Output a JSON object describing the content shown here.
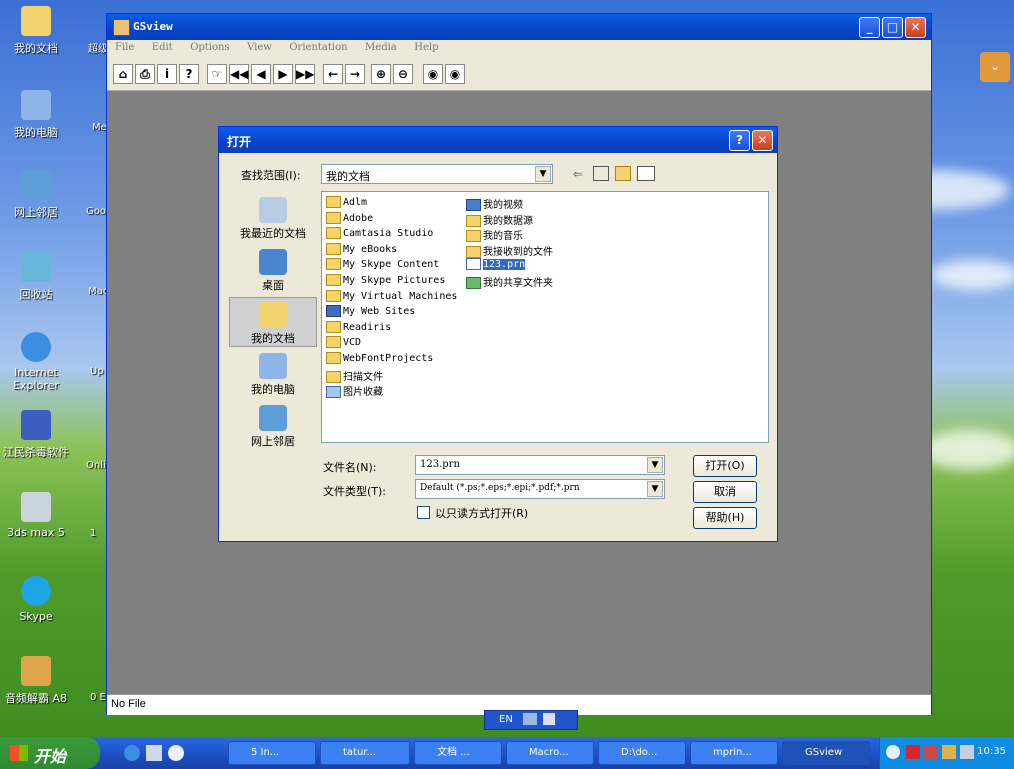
{
  "desktop": {
    "icons": [
      {
        "label": "我的文档"
      },
      {
        "label": "我的电脑"
      },
      {
        "label": "网上邻居"
      },
      {
        "label": "回收站"
      },
      {
        "label": "Internet Explorer"
      },
      {
        "label": "江民杀毒软件"
      },
      {
        "label": "3ds max 5"
      },
      {
        "label": "Skype"
      },
      {
        "label": "音频解霸 A8"
      }
    ],
    "cut_labels": [
      "超级",
      "Me",
      "Goo",
      "Mac Dre",
      "Up",
      "Onli",
      "1",
      "0 E"
    ]
  },
  "gsview": {
    "title": "GSview",
    "menu": [
      "File",
      "Edit",
      "Options",
      "View",
      "Orientation",
      "Media",
      "Help"
    ],
    "status": "No File"
  },
  "open_dialog": {
    "title": "打开",
    "look_in_label": "查找范围(I):",
    "look_in_value": "我的文档",
    "places": [
      {
        "label": "我最近的文档"
      },
      {
        "label": "桌面"
      },
      {
        "label": "我的文档"
      },
      {
        "label": "我的电脑"
      },
      {
        "label": "网上邻居"
      }
    ],
    "files_col1": [
      "Adlm",
      "Adobe",
      "Camtasia Studio",
      "My eBooks",
      "My Skype Content",
      "My Skype Pictures",
      "My Virtual Machines",
      "My Web Sites",
      "Readiris",
      "VCD",
      "WebFontProjects",
      "扫描文件",
      "图片收藏"
    ],
    "files_col2": [
      "我的视频",
      "我的数据源",
      "我的音乐",
      "我接收到的文件",
      "123.prn",
      "我的共享文件夹"
    ],
    "filename_label": "文件名(N):",
    "filename_value": "123.prn",
    "filetype_label": "文件类型(T):",
    "filetype_value": "Default (*.ps;*.eps;*.epi;*.pdf;*.prn",
    "readonly_label": "以只读方式打开(R)",
    "open_button": "打开(O)",
    "cancel_button": "取消",
    "help_button": "帮助(H)"
  },
  "taskbar": {
    "start": "开始",
    "buttons": [
      "5 In...",
      "tatur...",
      "文档 ...",
      "Macro...",
      "D:\\do...",
      "mprin...",
      "GSview"
    ],
    "clock": "10:35",
    "lang": "EN"
  }
}
